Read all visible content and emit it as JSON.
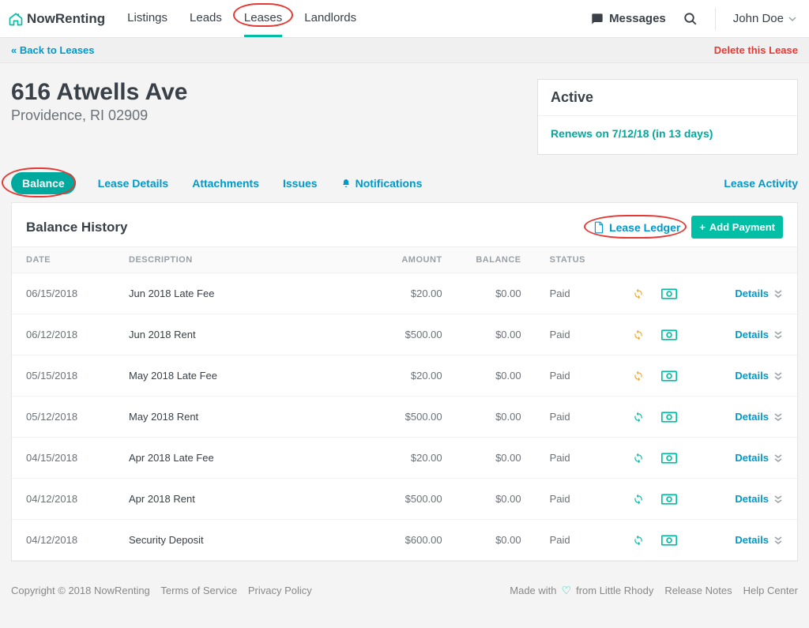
{
  "brand": "NowRenting",
  "nav": {
    "items": [
      "Listings",
      "Leads",
      "Leases",
      "Landlords"
    ],
    "active_index": 2
  },
  "right": {
    "messages": "Messages",
    "user": "John Doe"
  },
  "subbar": {
    "back": "« Back to Leases",
    "delete": "Delete this Lease"
  },
  "address": {
    "street": "616 Atwells Ave",
    "city": "Providence, RI 02909"
  },
  "status": {
    "title": "Active",
    "renew": "Renews on 7/12/18 (in 13 days)"
  },
  "tabs": {
    "items": [
      "Balance",
      "Lease Details",
      "Attachments",
      "Issues",
      "Notifications"
    ],
    "active_index": 0,
    "activity": "Lease Activity"
  },
  "panel": {
    "title": "Balance History",
    "ledger": "Lease Ledger",
    "add_payment": "Add Payment",
    "columns": {
      "date": "DATE",
      "description": "DESCRIPTION",
      "amount": "AMOUNT",
      "balance": "BALANCE",
      "status": "STATUS"
    },
    "details_label": "Details",
    "rows": [
      {
        "date": "06/15/2018",
        "description": "Jun 2018 Late Fee",
        "amount": "$20.00",
        "balance": "$0.00",
        "status": "Paid",
        "sync": "orange"
      },
      {
        "date": "06/12/2018",
        "description": "Jun 2018 Rent",
        "amount": "$500.00",
        "balance": "$0.00",
        "status": "Paid",
        "sync": "orange"
      },
      {
        "date": "05/15/2018",
        "description": "May 2018 Late Fee",
        "amount": "$20.00",
        "balance": "$0.00",
        "status": "Paid",
        "sync": "orange"
      },
      {
        "date": "05/12/2018",
        "description": "May 2018 Rent",
        "amount": "$500.00",
        "balance": "$0.00",
        "status": "Paid",
        "sync": "green"
      },
      {
        "date": "04/15/2018",
        "description": "Apr 2018 Late Fee",
        "amount": "$20.00",
        "balance": "$0.00",
        "status": "Paid",
        "sync": "green"
      },
      {
        "date": "04/12/2018",
        "description": "Apr 2018 Rent",
        "amount": "$500.00",
        "balance": "$0.00",
        "status": "Paid",
        "sync": "green"
      },
      {
        "date": "04/12/2018",
        "description": "Security Deposit",
        "amount": "$600.00",
        "balance": "$0.00",
        "status": "Paid",
        "sync": "green"
      }
    ]
  },
  "footer": {
    "copyright": "Copyright © 2018 NowRenting",
    "tos": "Terms of Service",
    "privacy": "Privacy Policy",
    "made_prefix": "Made with",
    "made_suffix": "from Little Rhody",
    "release": "Release Notes",
    "help": "Help Center"
  }
}
